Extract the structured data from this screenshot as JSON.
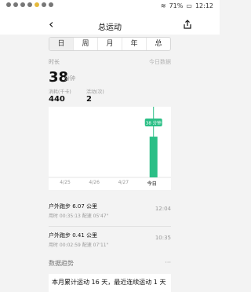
{
  "status_bar": {
    "left_dots": [
      "●",
      "●",
      "●",
      "●",
      "●",
      "●",
      "●"
    ],
    "battery": "71%",
    "time": "12:12"
  },
  "header": {
    "title": "总运动",
    "back_icon": "chevron-left-icon",
    "share_icon": "share-icon"
  },
  "tabs": [
    {
      "label": "日",
      "active": true
    },
    {
      "label": "周",
      "active": false
    },
    {
      "label": "月",
      "active": false
    },
    {
      "label": "年",
      "active": false
    },
    {
      "label": "总",
      "active": false
    }
  ],
  "summary": {
    "metric_label": "时长",
    "today_label": "今日数据",
    "value": "38",
    "unit": "分钟",
    "stat1_label": "消耗(千卡)",
    "stat1_value": "440",
    "stat2_label": "活动(次)",
    "stat2_value": "2"
  },
  "chart_data": {
    "type": "bar",
    "categories": [
      "4/25",
      "4/26",
      "4/27",
      "今日"
    ],
    "values": [
      0,
      0,
      0,
      38
    ],
    "ylim": [
      0,
      60
    ],
    "active_index": 3,
    "tooltip": "38 分钟",
    "colors": {
      "bar": "#2bbf86",
      "tooltip_bg": "#2bbf86",
      "marker": "#2bbf86"
    }
  },
  "workouts": [
    {
      "title": "户外跑步 6.07 公里",
      "detail": "用时 00:35:13   配速 05'47\"",
      "time": "12:04"
    },
    {
      "title": "户外跑步 0.41 公里",
      "detail": "用时 00:02:59   配速 07'11\"",
      "time": "10:35"
    }
  ],
  "trend": {
    "title": "数据趋势",
    "more": "···",
    "text": "本月累计运动 16 天，最近连续运动 1 天"
  }
}
